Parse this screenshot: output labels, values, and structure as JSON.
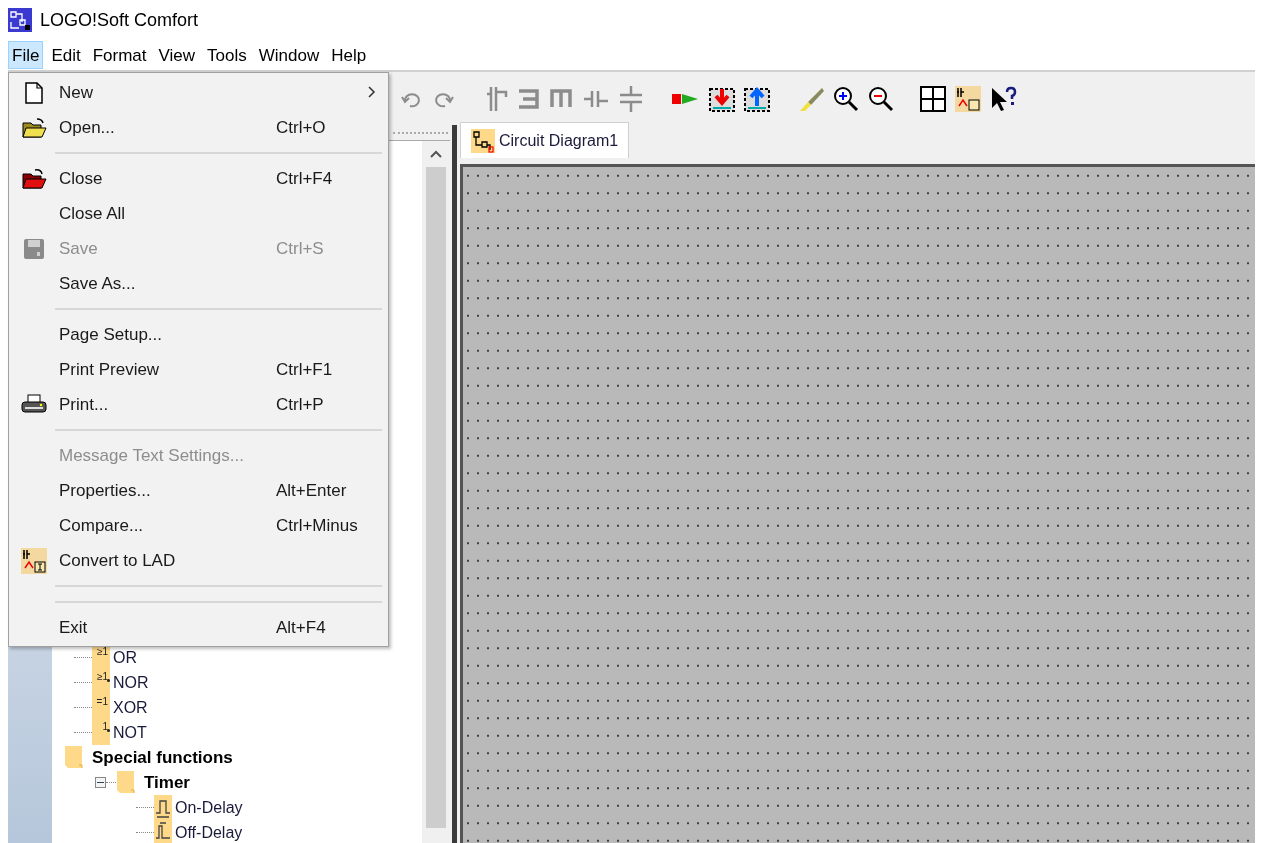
{
  "window": {
    "title": "LOGO!Soft Comfort"
  },
  "menu_bar": [
    {
      "label": "File",
      "selected": true
    },
    {
      "label": "Edit",
      "selected": false
    },
    {
      "label": "Format",
      "selected": false
    },
    {
      "label": "View",
      "selected": false
    },
    {
      "label": "Tools",
      "selected": false
    },
    {
      "label": "Window",
      "selected": false
    },
    {
      "label": "Help",
      "selected": false
    }
  ],
  "file_menu": [
    {
      "kind": "item",
      "label": "New",
      "submenu": true,
      "disabled": false
    },
    {
      "kind": "item",
      "label": "Open...",
      "shortcut": "Ctrl+O",
      "disabled": false
    },
    {
      "kind": "separator"
    },
    {
      "kind": "item",
      "label": "Close",
      "shortcut": "Ctrl+F4",
      "disabled": false
    },
    {
      "kind": "item",
      "label": "Close All",
      "disabled": false
    },
    {
      "kind": "item",
      "label": "Save",
      "shortcut": "Ctrl+S",
      "disabled": true
    },
    {
      "kind": "item",
      "label": "Save As...",
      "disabled": false
    },
    {
      "kind": "separator"
    },
    {
      "kind": "item",
      "label": "Page Setup...",
      "disabled": false
    },
    {
      "kind": "item",
      "label": "Print Preview",
      "shortcut": "Ctrl+F1",
      "disabled": false
    },
    {
      "kind": "item",
      "label": "Print...",
      "shortcut": "Ctrl+P",
      "disabled": false
    },
    {
      "kind": "separator"
    },
    {
      "kind": "item",
      "label": "Message Text Settings...",
      "disabled": true
    },
    {
      "kind": "item",
      "label": "Properties...",
      "shortcut": "Alt+Enter",
      "disabled": false
    },
    {
      "kind": "item",
      "label": "Compare...",
      "shortcut": "Ctrl+Minus",
      "disabled": false
    },
    {
      "kind": "item",
      "label": "Convert to LAD",
      "disabled": false
    },
    {
      "kind": "separator"
    },
    {
      "kind": "separator"
    },
    {
      "kind": "item",
      "label": "Exit",
      "shortcut": "Alt+F4",
      "disabled": false
    }
  ],
  "tree": [
    {
      "kind": "block",
      "label": "OR",
      "symbol": "≥1",
      "negated": false
    },
    {
      "kind": "block",
      "label": "NOR",
      "symbol": "≥1",
      "negated": true
    },
    {
      "kind": "block",
      "label": "XOR",
      "symbol": "=1",
      "negated": false
    },
    {
      "kind": "block",
      "label": "NOT",
      "symbol": "1",
      "negated": true
    },
    {
      "kind": "folder",
      "label": "Special functions",
      "children": [
        {
          "kind": "folder",
          "label": "Timer",
          "expanded": true,
          "children": [
            {
              "kind": "timer",
              "label": "On-Delay"
            },
            {
              "kind": "timer",
              "label": "Off-Delay"
            }
          ]
        }
      ]
    }
  ],
  "tabs": [
    {
      "label": "Circuit Diagram1",
      "selected": true
    }
  ]
}
